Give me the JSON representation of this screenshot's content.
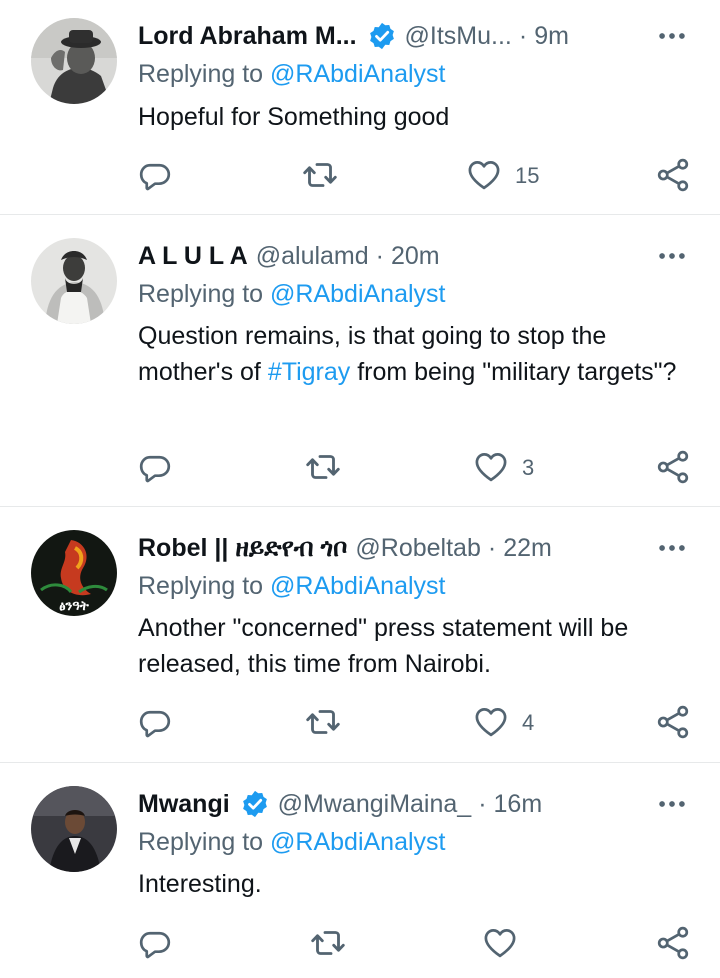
{
  "tweets": [
    {
      "name": "Lord Abraham M...",
      "handle": "@ItsMu...",
      "separator": "·",
      "time": "9m",
      "verified": true,
      "replying_prefix": "Replying to",
      "replying_to": "@RAbdiAnalyst",
      "text": "Hopeful for Something good",
      "like_count": "15"
    },
    {
      "name": "A L U L A",
      "handle": "@alulamd",
      "separator": "·",
      "time": "20m",
      "verified": false,
      "replying_prefix": "Replying to",
      "replying_to": "@RAbdiAnalyst",
      "text_before": "Question remains, is that going to stop the mother's of ",
      "hashtag": "#Tigray",
      "text_after": " from being \"military targets\"?",
      "like_count": "3"
    },
    {
      "name": "Robel || ዘይድየብ ጎቦ",
      "handle": "@Robeltab",
      "separator": "·",
      "time": "22m",
      "verified": false,
      "avatar_text": "ፅንዓት",
      "replying_prefix": "Replying to",
      "replying_to": "@RAbdiAnalyst",
      "text": "Another \"concerned\" press statement will be released, this time from Nairobi.",
      "like_count": "4"
    },
    {
      "name": "Mwangi",
      "handle": "@MwangiMaina_",
      "separator": "·",
      "time": "16m",
      "verified": true,
      "replying_prefix": "Replying to",
      "replying_to": "@RAbdiAnalyst",
      "text": "Interesting.",
      "like_count": ""
    }
  ],
  "colors": {
    "text": "#0f1419",
    "secondary": "#536471",
    "accent": "#1d9bf0",
    "divider": "#e7e9ea"
  },
  "icons": [
    "verified-badge-icon",
    "more-icon",
    "reply-icon",
    "retweet-icon",
    "like-icon",
    "share-icon"
  ]
}
